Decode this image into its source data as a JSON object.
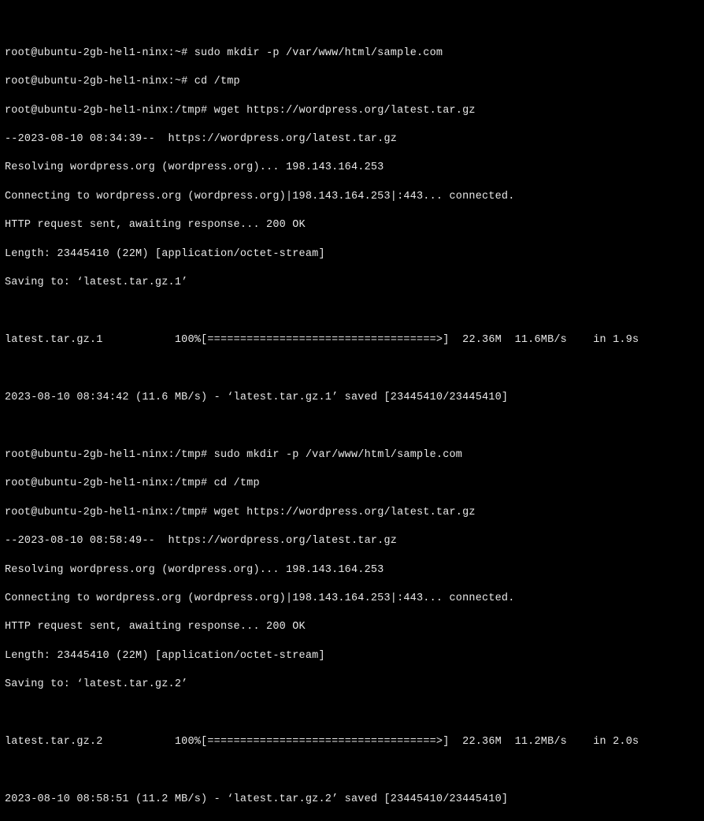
{
  "prompt1": "root@ubuntu-2gb-hel1-ninx:~#",
  "prompt1_cmd1": "sudo mkdir -p /var/www/html/sample.com",
  "prompt1_cmd2": "cd /tmp",
  "prompt2": "root@ubuntu-2gb-hel1-ninx:/tmp#",
  "wget_cmd": "wget https://wordpress.org/latest.tar.gz",
  "dl1": {
    "start_ts": "--2023-08-10 08:34:39--  https://wordpress.org/latest.tar.gz",
    "resolve": "Resolving wordpress.org (wordpress.org)... 198.143.164.253",
    "connect": "Connecting to wordpress.org (wordpress.org)|198.143.164.253|:443... connected.",
    "http": "HTTP request sent, awaiting response... 200 OK",
    "length": "Length: 23445410 (22M) [application/octet-stream]",
    "saving_to": "Saving to: ‘latest.tar.gz.1’",
    "progress_file": "latest.tar.gz.1",
    "progress_pct": "100%",
    "progress_bar": "[===================================>]",
    "progress_size": "22.36M",
    "progress_rate": "11.6MB/s",
    "progress_in": "in 1.9s",
    "done": "2023-08-10 08:34:42 (11.6 MB/s) - ‘latest.tar.gz.1’ saved [23445410/23445410]"
  },
  "dup_mkdir": "sudo mkdir -p /var/www/html/sample.com",
  "dup_cd": "cd /tmp",
  "dl2": {
    "start_ts": "--2023-08-10 08:58:49--  https://wordpress.org/latest.tar.gz",
    "resolve": "Resolving wordpress.org (wordpress.org)... 198.143.164.253",
    "connect": "Connecting to wordpress.org (wordpress.org)|198.143.164.253|:443... connected.",
    "http": "HTTP request sent, awaiting response... 200 OK",
    "length": "Length: 23445410 (22M) [application/octet-stream]",
    "saving_to": "Saving to: ‘latest.tar.gz.2’",
    "progress_file": "latest.tar.gz.2",
    "progress_pct": "100%",
    "progress_bar": "[===================================>]",
    "progress_size": "22.36M",
    "progress_rate": "11.2MB/s",
    "progress_in": "in 2.0s",
    "done": "2023-08-10 08:58:51 (11.2 MB/s) - ‘latest.tar.gz.2’ saved [23445410/23445410]"
  }
}
